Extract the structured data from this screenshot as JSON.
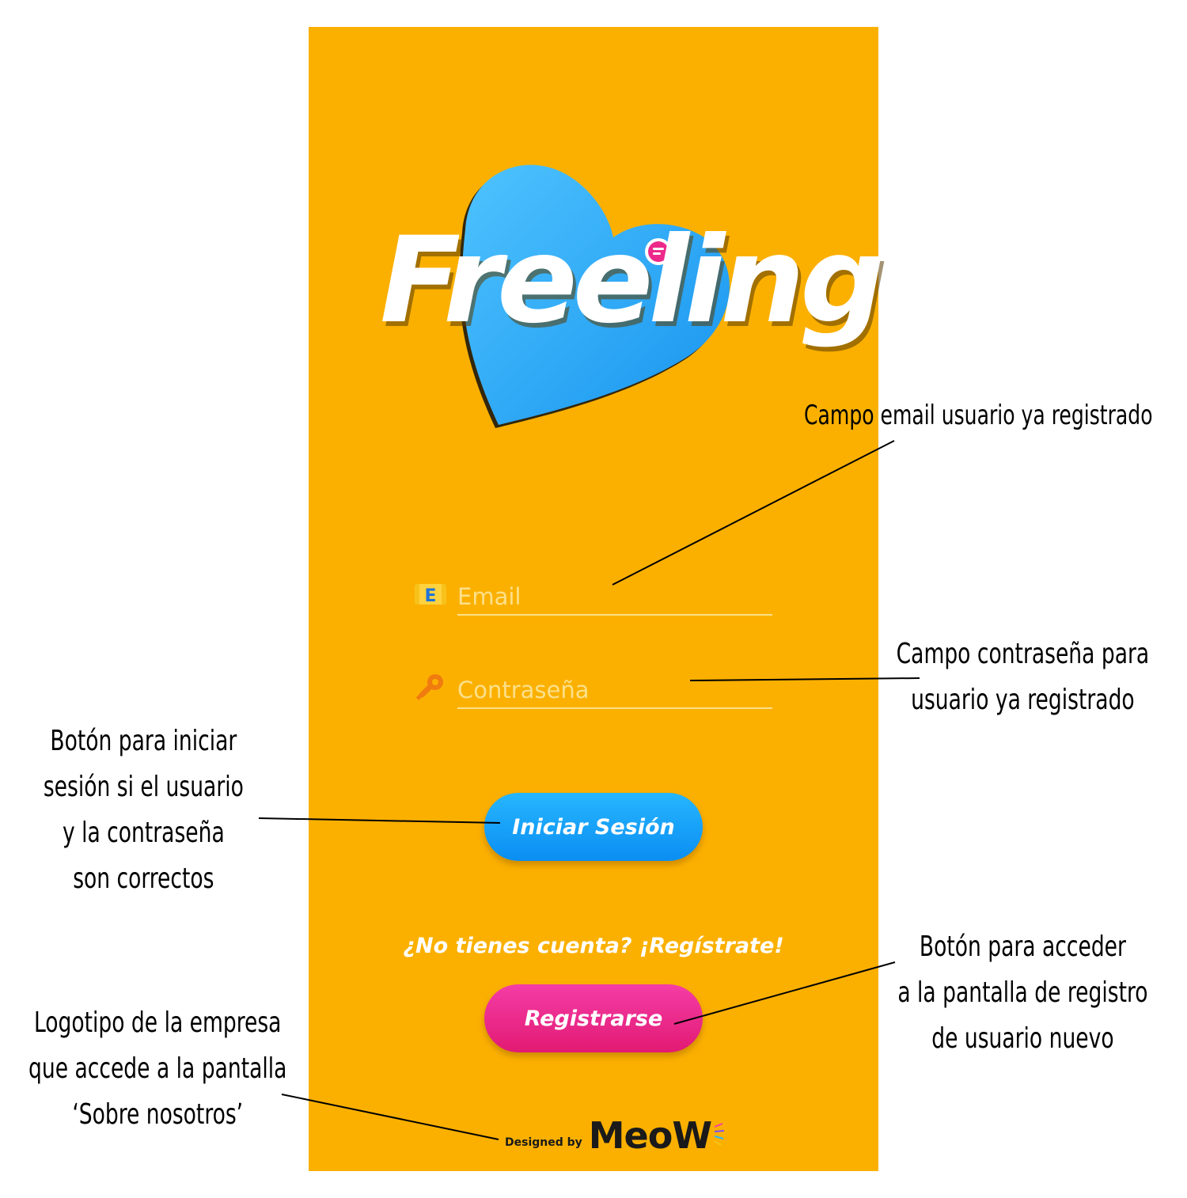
{
  "app": {
    "logo_text": "Freeling",
    "email_placeholder": "Email",
    "password_placeholder": "Contraseña",
    "login_button": "Iniciar Sesión",
    "no_account_text": "¿No tienes cuenta? ¡Regístrate!",
    "register_button": "Registrarse",
    "designed_by": "Designed by",
    "company_logo": "MeoW"
  },
  "annotations": {
    "email": "Campo email usuario ya registrado",
    "password": [
      "Campo contraseña para",
      "usuario ya registrado"
    ],
    "login": [
      "Botón para iniciar",
      "sesión si el usuario",
      "y la contraseña",
      "son correctos"
    ],
    "register": [
      "Botón para acceder",
      "a la pantalla de registro",
      "de usuario nuevo"
    ],
    "company": [
      "Logotipo de la empresa",
      "que accede a la pantalla",
      "‘Sobre nosotros’"
    ]
  },
  "colors": {
    "background": "#FBB000",
    "heart": "#25A9F5",
    "login_button": "#1AA0FA",
    "register_button": "#EC2A8A",
    "placeholder": "#FCE08A"
  },
  "icons": {
    "email": "email-e-icon",
    "password": "key-icon",
    "chat_bubble": "chat-bubble-icon"
  }
}
